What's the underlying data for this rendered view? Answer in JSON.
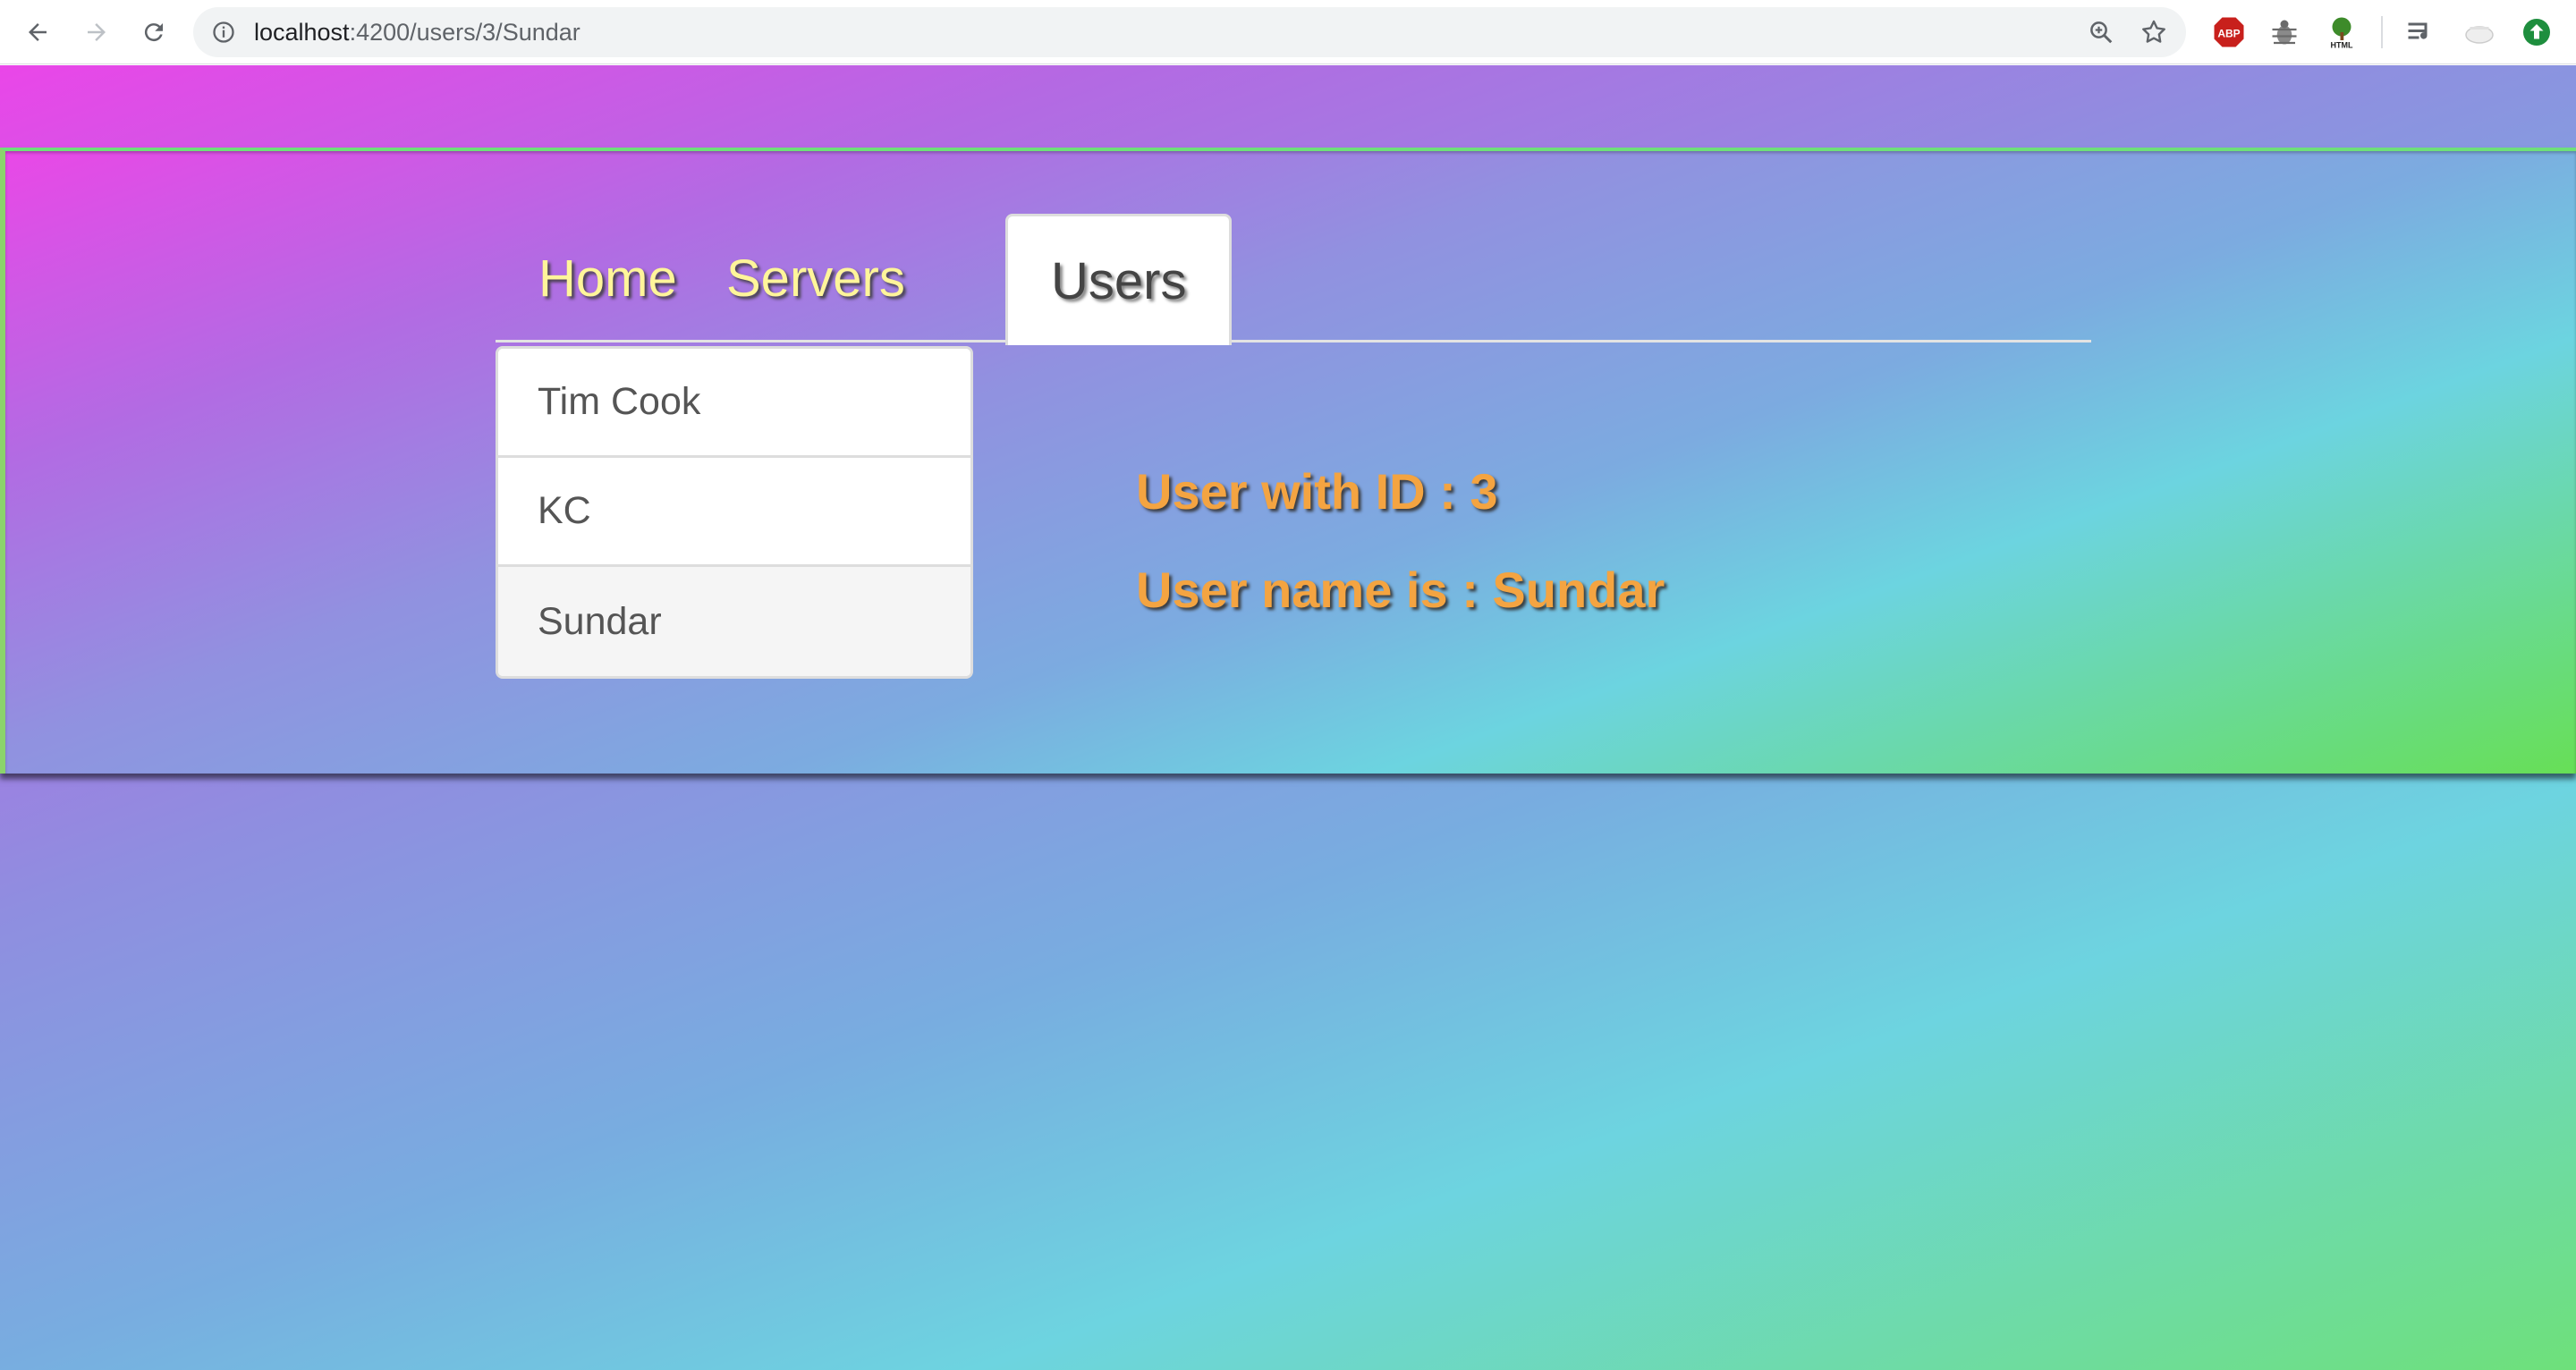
{
  "browser": {
    "url_host": "localhost",
    "url_path": ":4200/users/3/Sundar",
    "icons": [
      "back-icon",
      "forward-icon",
      "reload-icon",
      "info-icon",
      "zoom-icon",
      "star-icon",
      "adblock-icon",
      "bug-icon",
      "tree-icon",
      "media-icon",
      "profile-icon",
      "update-icon"
    ],
    "adblock_label": "ABP",
    "tree_label": "HTML"
  },
  "colors": {
    "tab_text": "#fff59a",
    "detail_text": "#f4a441",
    "gradient_start": "#ea46e8",
    "gradient_mid": "#6dd4e0",
    "gradient_end": "#6ee07a"
  },
  "nav": {
    "tabs": [
      {
        "label": "Home",
        "active": false
      },
      {
        "label": "Servers",
        "active": false
      },
      {
        "label": "Users",
        "active": true
      }
    ]
  },
  "users": {
    "items": [
      {
        "label": "Tim Cook",
        "active": false
      },
      {
        "label": "KC",
        "active": false
      },
      {
        "label": "Sundar",
        "active": true
      }
    ]
  },
  "detail": {
    "id_text": "User with ID : 3",
    "name_text": "User name is : Sundar"
  }
}
